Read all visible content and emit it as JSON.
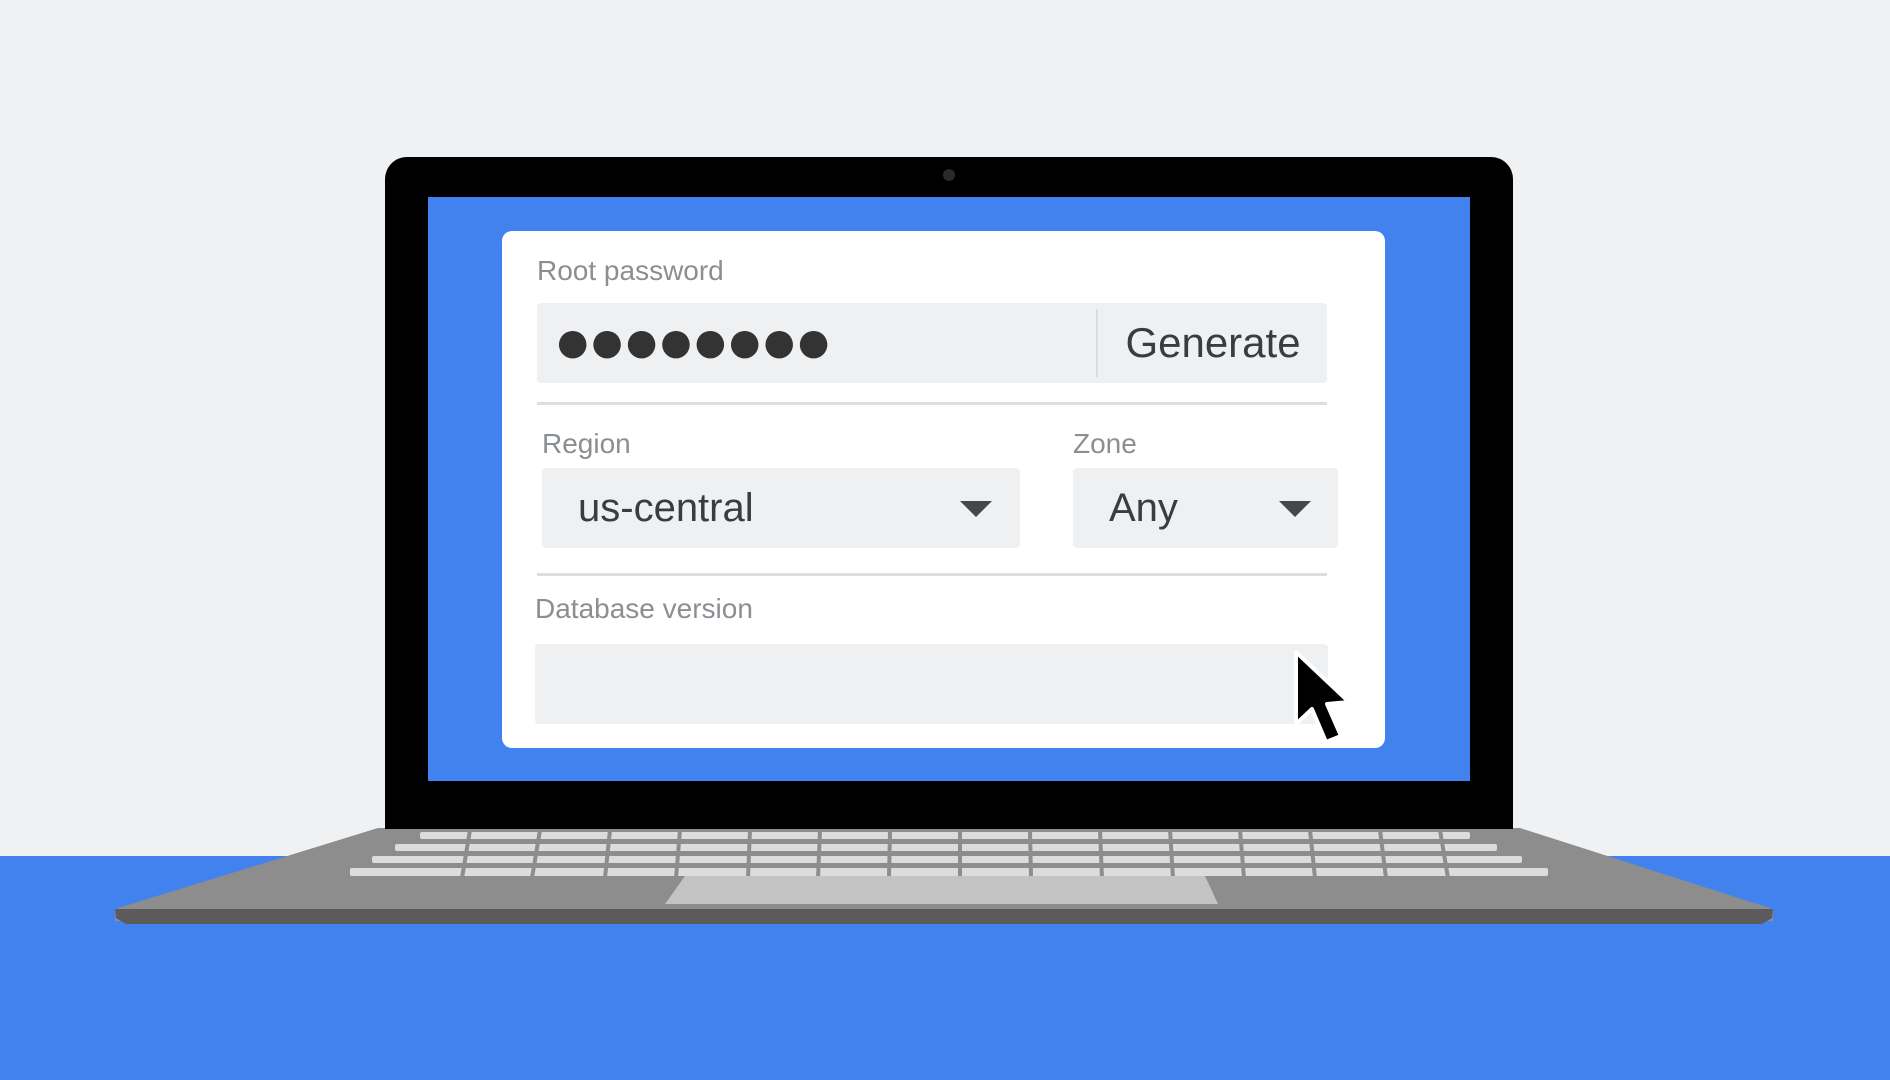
{
  "form": {
    "root_password_label": "Root password",
    "root_password_value": "●●●●●●●●",
    "generate_label": "Generate",
    "region_label": "Region",
    "region_value": "us-central",
    "zone_label": "Zone",
    "zone_value": "Any",
    "database_version_label": "Database version",
    "database_version_value": ""
  },
  "icons": {
    "dropdown": "chevron-down-icon",
    "pointer": "mouse-cursor-icon",
    "camera": "webcam-icon"
  },
  "colors": {
    "brand_blue": "#4282ee",
    "background": "#eff1f3",
    "field_bg": "#eff0f2",
    "label": "#8b8e92"
  }
}
